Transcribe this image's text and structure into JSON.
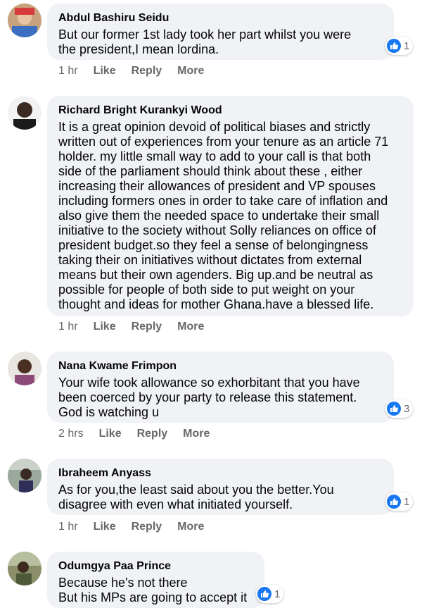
{
  "comments": [
    {
      "name": "Abdul Bashiru Seidu",
      "lines": [
        "But our former 1st lady took her part whilst you were",
        "the president,I mean lordina."
      ],
      "time": "1 hr",
      "reactions": "1"
    },
    {
      "name": "Richard Bright Kurankyi Wood",
      "lines": [
        "It is a great opinion devoid of political biases and strictly",
        "written out of experiences from your tenure as an article 71",
        "holder. my little small way to add to your call is that both",
        "side of the parliament should think about these , either",
        "increasing their allowances of president and VP spouses",
        "including formers ones in order to take care of inflation and",
        "also give them the needed space to undertake their small",
        "initiative to the society without Solly reliances on office of",
        "president budget.so they feel a sense of belongingness",
        "taking their on initiatives without dictates from external",
        "means but their own agenders. Big up.and be neutral as",
        "possible for people of both side to put weight on your",
        "thought and ideas for mother Ghana.have a blessed life."
      ],
      "time": "1 hr"
    },
    {
      "name": "Nana Kwame Frimpon",
      "lines": [
        "Your wife took allowance so exhorbitant that you have",
        "been coerced by your party to release this statement.",
        "God is watching u"
      ],
      "time": "2 hrs",
      "reactions": "3"
    },
    {
      "name": "Ibraheem Anyass",
      "lines": [
        "As for you,the least said about you the better.You",
        "disagree with even what initiated yourself."
      ],
      "time": "1 hr",
      "reactions": "1"
    },
    {
      "name": "Odumgya Paa Prince",
      "lines": [
        "Because he's not there",
        "But his MPs are going to accept it"
      ],
      "reactions": "1"
    }
  ],
  "actions": {
    "like": "Like",
    "reply": "Reply",
    "more": "More"
  },
  "colors": {
    "bubble": "#f0f2f5",
    "meta": "#65676b",
    "like_blue": "#1877f2"
  }
}
